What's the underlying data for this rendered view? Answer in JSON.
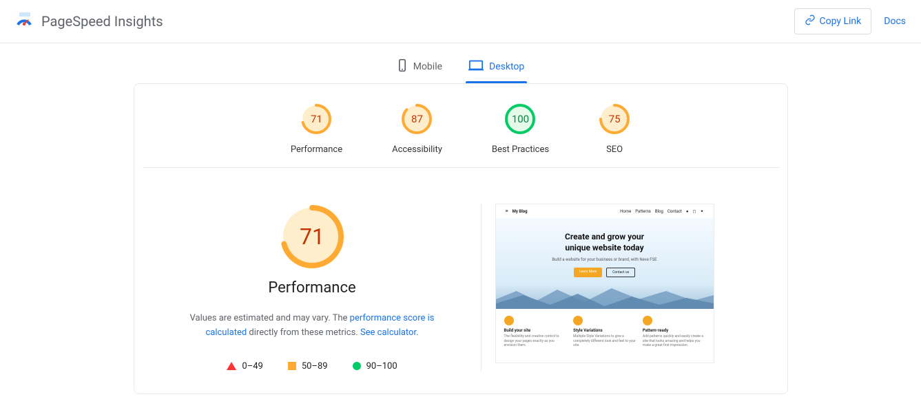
{
  "header": {
    "title": "PageSpeed Insights",
    "copy_link": "Copy Link",
    "docs": "Docs"
  },
  "tabs": {
    "mobile": "Mobile",
    "desktop": "Desktop"
  },
  "gauges": [
    {
      "score": "71",
      "label": "Performance",
      "level": "avg"
    },
    {
      "score": "87",
      "label": "Accessibility",
      "level": "avg"
    },
    {
      "score": "100",
      "label": "Best Practices",
      "level": "good"
    },
    {
      "score": "75",
      "label": "SEO",
      "level": "avg"
    }
  ],
  "main": {
    "score": "71",
    "title": "Performance",
    "desc_prefix": "Values are estimated and may vary. The ",
    "desc_link1": "performance score is calculated",
    "desc_mid": " directly from these metrics. ",
    "desc_link2": "See calculator."
  },
  "legend": {
    "fail": "0–49",
    "avg": "50–89",
    "good": "90–100"
  },
  "preview": {
    "site_name": "My Blog",
    "nav": [
      "Home",
      "Patterns",
      "Blog",
      "Contact"
    ],
    "hero_l1": "Create and grow your",
    "hero_l2": "unique website today",
    "hero_sub": "Build a website for your business or brand, with Neve FSE",
    "btn1": "Learn More",
    "btn2": "Contact us",
    "features": [
      {
        "title": "Build your site",
        "desc": "The flexibility and creative control to design your pages exactly as you envision them."
      },
      {
        "title": "Style Variations",
        "desc": "Multiple Style Variations to give a completely different look and feel to your site."
      },
      {
        "title": "Pattern-ready",
        "desc": "Add patterns quickly and easily create a site that looks amazing and helps you make a great first impression."
      }
    ]
  }
}
